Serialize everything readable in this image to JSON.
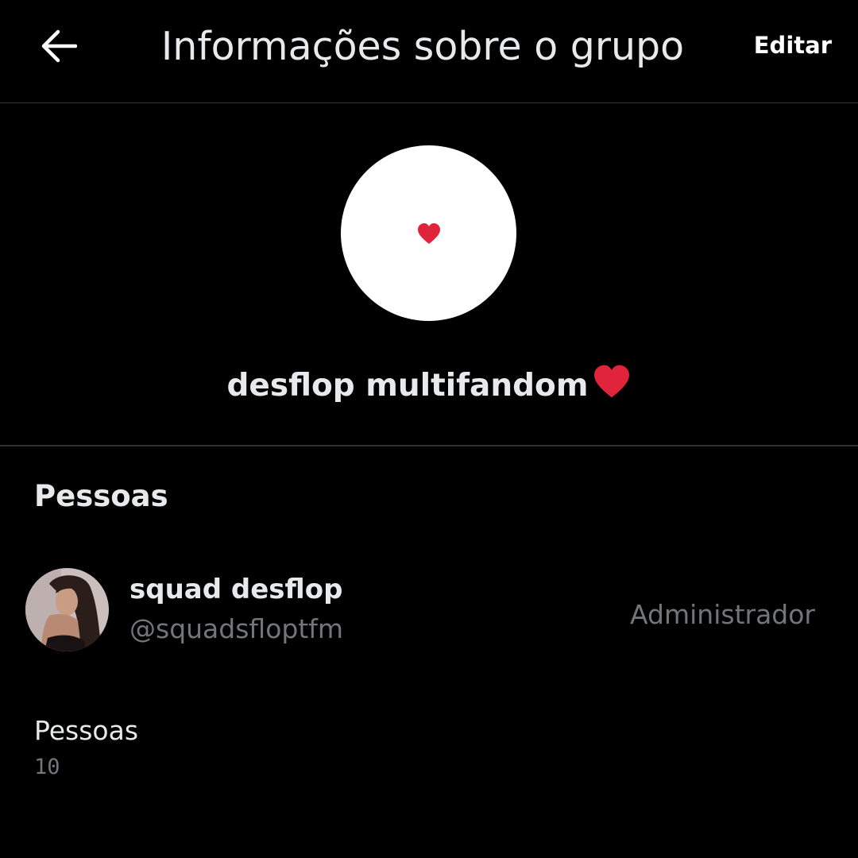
{
  "header": {
    "title": "Informações sobre o grupo",
    "edit_label": "Editar",
    "back_icon": "arrow-left-icon"
  },
  "group": {
    "name": "desflop multifandom",
    "avatar_icon": "heart-icon",
    "accent_color": "#e0243b"
  },
  "people_section": {
    "title": "Pessoas",
    "members": [
      {
        "display_name": "squad desflop",
        "handle": "@squadsfloptfm",
        "role": "Administrador"
      }
    ],
    "count_label": "Pessoas",
    "count_value": "10"
  },
  "colors": {
    "background": "#000000",
    "primary_text": "#e7e9ea",
    "secondary_text": "#71767b",
    "divider": "#2f3336"
  }
}
